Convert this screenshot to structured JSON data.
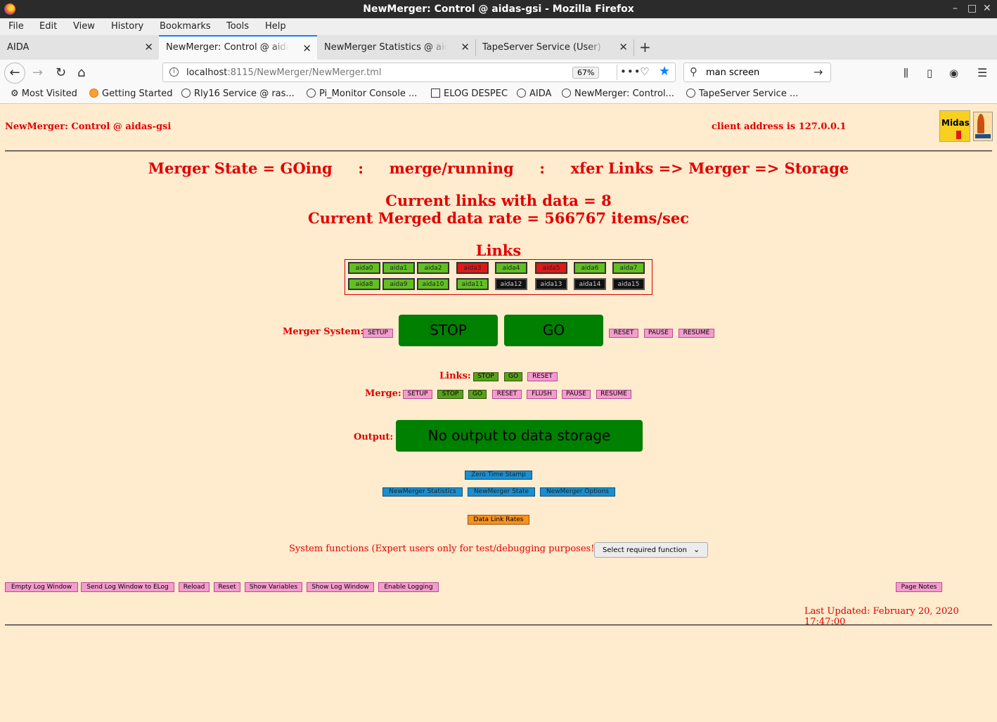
{
  "window": {
    "title": "NewMerger: Control @ aidas-gsi - Mozilla Firefox"
  },
  "menu": [
    "File",
    "Edit",
    "View",
    "History",
    "Bookmarks",
    "Tools",
    "Help"
  ],
  "tabs": [
    {
      "label": "AIDA"
    },
    {
      "label": "NewMerger: Control @ aidas"
    },
    {
      "label": "NewMerger Statistics @ aida"
    },
    {
      "label": "TapeServer Service (User) @"
    }
  ],
  "nav": {
    "url_host": "localhost",
    "url_path": ":8115/NewMerger/NewMerger.tml",
    "zoom": "67%",
    "search_value": "man screen"
  },
  "bookmarks": [
    "Most Visited",
    "Getting Started",
    "Rly16 Service @ ras...",
    "Pi_Monitor Console ...",
    "ELOG DESPEC",
    "AIDA",
    "NewMerger: Control...",
    "TapeServer Service ..."
  ],
  "page": {
    "heading": "NewMerger: Control @ aidas-gsi",
    "client_address": "client address is 127.0.0.1",
    "logo_text": "Midas",
    "state_line": "Merger State = GOing     :     merge/running     :     xfer Links => Merger => Storage",
    "links_with_data": "Current links with data = 8",
    "data_rate": "Current Merged data rate = 566767 items/sec",
    "links_title": "Links",
    "links": [
      {
        "label": "aida0",
        "status": "green"
      },
      {
        "label": "aida1",
        "status": "green"
      },
      {
        "label": "aida2",
        "status": "green"
      },
      {
        "label": "aida3",
        "status": "red"
      },
      {
        "label": "aida4",
        "status": "green"
      },
      {
        "label": "aida5",
        "status": "red"
      },
      {
        "label": "aida6",
        "status": "green"
      },
      {
        "label": "aida7",
        "status": "green"
      },
      {
        "label": "aida8",
        "status": "green"
      },
      {
        "label": "aida9",
        "status": "green"
      },
      {
        "label": "aida10",
        "status": "green"
      },
      {
        "label": "aida11",
        "status": "green"
      },
      {
        "label": "aida12",
        "status": "black"
      },
      {
        "label": "aida13",
        "status": "black"
      },
      {
        "label": "aida14",
        "status": "black"
      },
      {
        "label": "aida15",
        "status": "black"
      }
    ],
    "merger_system": {
      "label": "Merger System:",
      "setup": "SETUP",
      "stop": "STOP",
      "go": "GO",
      "reset": "RESET",
      "pause": "PAUSE",
      "resume": "RESUME"
    },
    "links_ctrl": {
      "label": "Links:",
      "stop": "STOP",
      "go": "GO",
      "reset": "RESET"
    },
    "merge_ctrl": {
      "label": "Merge:",
      "setup": "SETUP",
      "stop": "STOP",
      "go": "GO",
      "reset": "RESET",
      "flush": "FLUSH",
      "pause": "PAUSE",
      "resume": "RESUME"
    },
    "output": {
      "label": "Output:",
      "value": "No output to data storage"
    },
    "zero_time_stamp": "Zero Time Stamp",
    "nav_buttons": [
      "NewMerger Statistics",
      "NewMerger State",
      "NewMerger Options"
    ],
    "data_link_rates": "Data Link Rates",
    "system_functions": "System functions (Expert users only for test/debugging purposes!!!)",
    "system_select": "Select required function",
    "log_buttons": [
      "Empty Log Window",
      "Send Log Window to ELog",
      "Reload",
      "Reset",
      "Show Variables",
      "Show Log Window",
      "Enable Logging"
    ],
    "page_notes": "Page Notes",
    "last_updated": "Last Updated: February 20, 2020 17:47:00"
  },
  "colors": {
    "page_bg": "#ffebcd",
    "accent_red": "#e00000",
    "big_button_green": "#008000",
    "link_ok": "#60c020",
    "link_error": "#e01818",
    "link_off": "#111111"
  }
}
